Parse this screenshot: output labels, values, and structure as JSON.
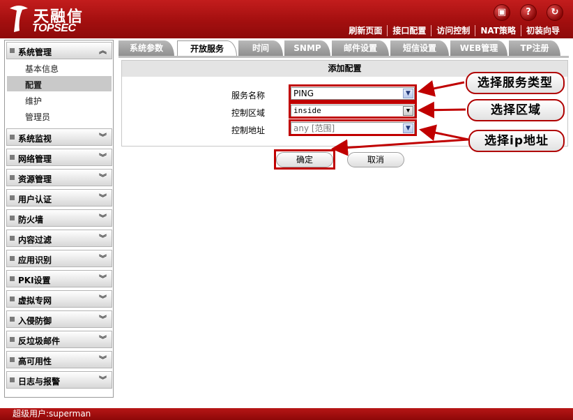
{
  "header": {
    "logo_cn": "天融信",
    "logo_en": "TOPSEC",
    "icons": [
      "save-icon",
      "help-icon",
      "logout-icon"
    ],
    "nav": [
      "刷新页面",
      "接口配置",
      "访问控制",
      "NAT策略",
      "初装向导"
    ]
  },
  "sidebar": {
    "sections": [
      {
        "label": "系统管理",
        "expanded": true
      },
      {
        "label": "系统监视"
      },
      {
        "label": "网络管理"
      },
      {
        "label": "资源管理"
      },
      {
        "label": "用户认证"
      },
      {
        "label": "防火墙"
      },
      {
        "label": "内容过滤"
      },
      {
        "label": "应用识别"
      },
      {
        "label": "PKI设置"
      },
      {
        "label": "虚拟专网"
      },
      {
        "label": "入侵防御"
      },
      {
        "label": "反垃圾邮件"
      },
      {
        "label": "高可用性"
      },
      {
        "label": "日志与报警"
      }
    ],
    "sub_items": [
      "基本信息",
      "配置",
      "维护",
      "管理员"
    ],
    "active_sub": "配置"
  },
  "tabs": [
    "系统参数",
    "开放服务",
    "时间",
    "SNMP",
    "邮件设置",
    "短信设置",
    "WEB管理",
    "TP注册"
  ],
  "active_tab": "开放服务",
  "form": {
    "title": "添加配置",
    "fields": [
      {
        "label": "服务名称",
        "value": "PING"
      },
      {
        "label": "控制区域",
        "value": "inside"
      },
      {
        "label": "控制地址",
        "value": "any [范围]"
      }
    ],
    "ok_label": "确定",
    "cancel_label": "取消"
  },
  "callouts": [
    "选择服务类型",
    "选择区域",
    "选择ip地址"
  ],
  "status_bar": {
    "text": "超级用户:superman"
  },
  "colors": {
    "header_red": "#a30f0f",
    "callout_border": "#b00000",
    "highlight_red": "#c00000"
  }
}
